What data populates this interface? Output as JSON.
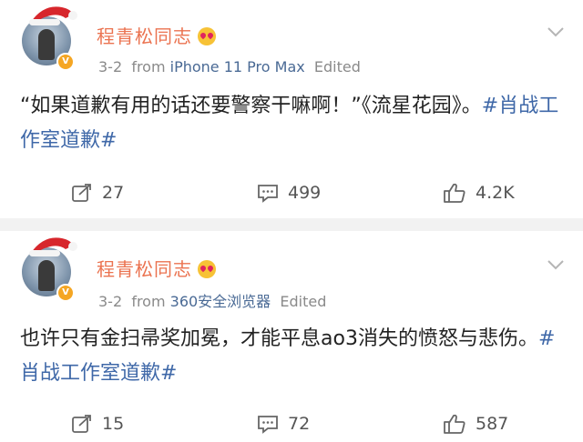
{
  "posts": [
    {
      "author": "程青松同志",
      "date": "3-2",
      "from": "from",
      "source": "iPhone 11 Pro Max",
      "edited": "Edited",
      "text": "“如果道歉有用的话还要警察干嘛啊！”《流星花园》。",
      "hashtag": "#肖战工作室道歉#",
      "reposts": "27",
      "comments": "499",
      "likes": "4.2K"
    },
    {
      "author": "程青松同志",
      "date": "3-2",
      "from": "from",
      "source": "360安全浏览器",
      "edited": "Edited",
      "text": "也许只有金扫帚奖加冕，才能平息ao3消失的愤怒与悲伤。",
      "hashtag": "#肖战工作室道歉#",
      "reposts": "15",
      "comments": "72",
      "likes": "587"
    }
  ],
  "colors": {
    "name": "#eb7350",
    "link": "#3f68a8",
    "meta": "#8a8a8a",
    "source": "#4a6a95",
    "verified": "#f5a623"
  }
}
